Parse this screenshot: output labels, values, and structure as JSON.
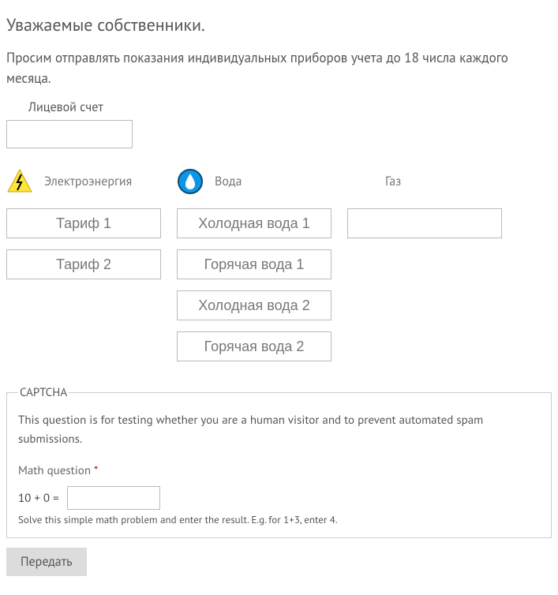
{
  "title": "Уважаемые собственники.",
  "intro": "Просим отправлять показания индивидуальных приборов учета до 18 числа каждого месяца.",
  "account": {
    "label": "Лицевой счет",
    "value": ""
  },
  "columns": {
    "electricity": {
      "label": "Электроэнергия",
      "inputs": [
        {
          "placeholder": "Тариф 1",
          "value": ""
        },
        {
          "placeholder": "Тариф 2",
          "value": ""
        }
      ]
    },
    "water": {
      "label": "Вода",
      "inputs": [
        {
          "placeholder": "Холодная вода 1",
          "value": ""
        },
        {
          "placeholder": "Горячая вода 1",
          "value": ""
        },
        {
          "placeholder": "Холодная вода 2",
          "value": ""
        },
        {
          "placeholder": "Горячая вода 2",
          "value": ""
        }
      ]
    },
    "gas": {
      "label": "Газ",
      "inputs": [
        {
          "placeholder": "",
          "value": ""
        }
      ]
    }
  },
  "captcha": {
    "legend": "CAPTCHA",
    "description": "This question is for testing whether you are a human visitor and to prevent automated spam submissions.",
    "math_label": "Math question",
    "required_mark": "*",
    "question": "10 + 0 =",
    "answer": "",
    "help": "Solve this simple math problem and enter the result. E.g. for 1+3, enter 4."
  },
  "submit_label": "Передать"
}
